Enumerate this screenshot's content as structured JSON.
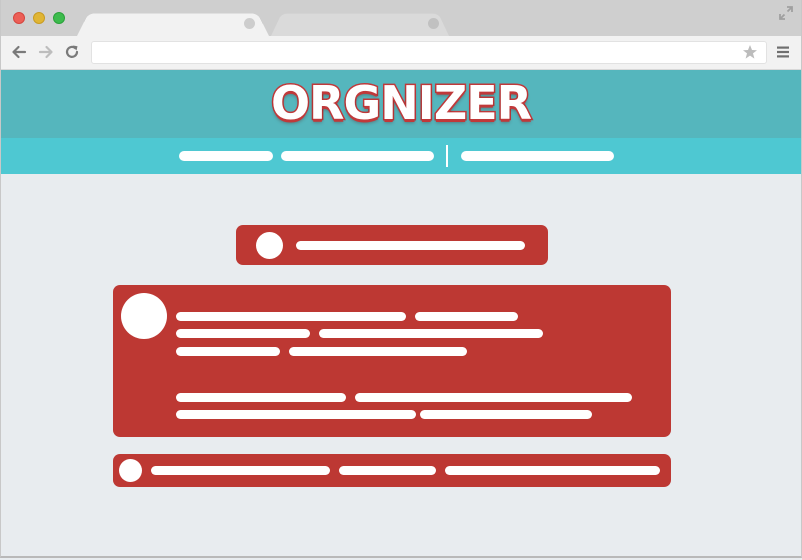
{
  "browser": {
    "address_bar": {
      "value": "",
      "placeholder": ""
    },
    "icons": {
      "back": "arrow-left-icon",
      "forward": "arrow-right-icon",
      "reload": "reload-icon",
      "bookmark": "star-icon",
      "menu": "hamburger-menu-icon",
      "fullscreen": "expand-icon"
    }
  },
  "site": {
    "logo_text": "ORGNIZER"
  },
  "colors": {
    "header_teal": "#55b6bd",
    "nav_cyan": "#4ec8d2",
    "card_red": "#bd3833",
    "page_background": "#e8ecef"
  }
}
